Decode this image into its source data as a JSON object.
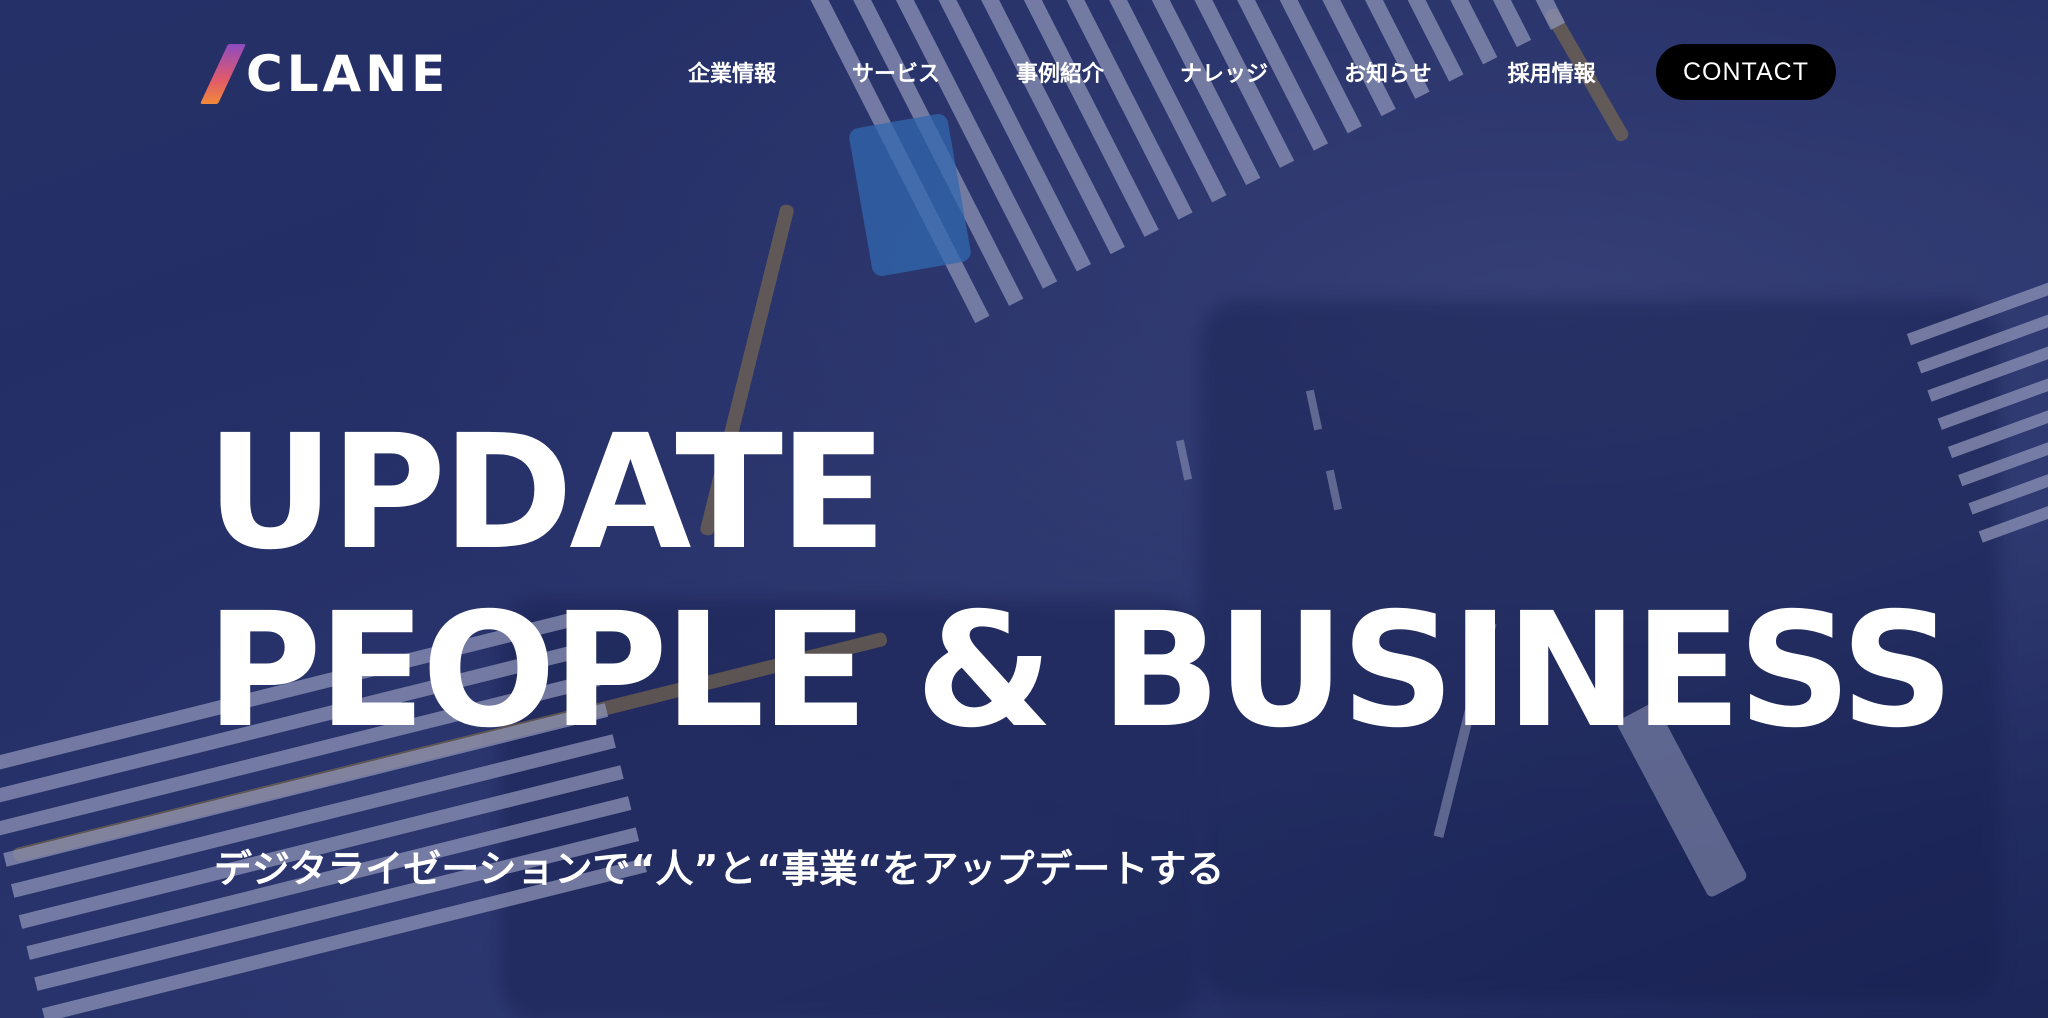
{
  "brand": {
    "name": "CLANE",
    "colors": {
      "overlay": "#26316a",
      "contact_bg": "#000000",
      "text": "#ffffff"
    }
  },
  "nav": {
    "items": [
      {
        "label": "企業情報"
      },
      {
        "label": "サービス"
      },
      {
        "label": "事例紹介"
      },
      {
        "label": "ナレッジ"
      },
      {
        "label": "お知らせ"
      },
      {
        "label": "採用情報"
      }
    ],
    "contact_label": "CONTACT"
  },
  "hero": {
    "headline_line1": "UPDATE",
    "headline_line2": "PEOPLE & BUSINESS",
    "tagline": "デジタライゼーションで“人”と“事業“をアップデートする"
  }
}
